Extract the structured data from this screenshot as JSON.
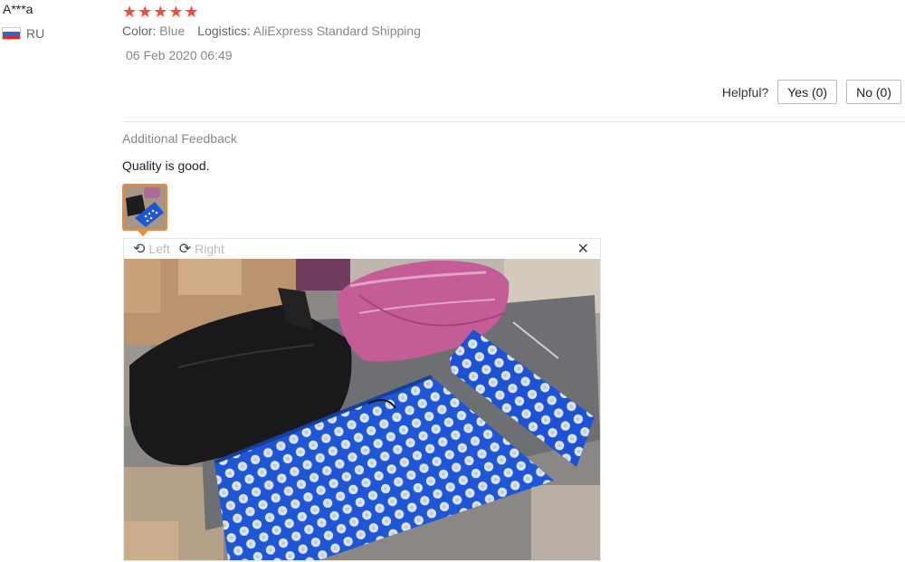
{
  "review": {
    "reviewer": "A***a",
    "country_code": "RU",
    "rating_stars": "★★★★★",
    "rating": 5,
    "color_label": "Color:",
    "color_value": "Blue",
    "logistics_label": "Logistics:",
    "logistics_value": "AliExpress Standard Shipping",
    "date": "06 Feb 2020 06:49"
  },
  "helpful": {
    "label": "Helpful?",
    "yes_label": "Yes (0)",
    "no_label": "No (0)"
  },
  "feedback": {
    "heading": "Additional Feedback",
    "text": "Quality is good."
  },
  "viewer": {
    "rotate_left_label": "Left",
    "rotate_right_label": "Right",
    "close_glyph": "✕"
  },
  "colors": {
    "star": "#f04b3d",
    "thumb_border": "#f08a3a",
    "mat_blue": "#1f56d6"
  }
}
